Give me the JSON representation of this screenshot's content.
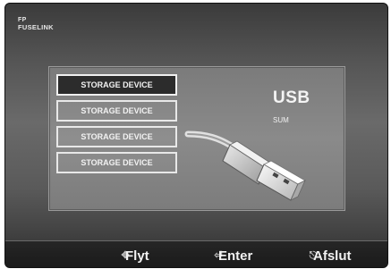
{
  "brand": {
    "logo": "FP",
    "name": "FUSELINK"
  },
  "devices": [
    {
      "label": "STORAGE DEVICE",
      "selected": true
    },
    {
      "label": "STORAGE DEVICE",
      "selected": false
    },
    {
      "label": "STORAGE DEVICE",
      "selected": false
    },
    {
      "label": "STORAGE DEVICE",
      "selected": false
    }
  ],
  "usb": {
    "title": "USB",
    "subtitle": "SUM"
  },
  "help": [
    {
      "icon": "move-arrows-icon",
      "label": "Flyt"
    },
    {
      "icon": "enter-icon",
      "label": "Enter"
    },
    {
      "icon": "exit-icon",
      "label": "Afslut"
    }
  ],
  "colors": {
    "background": "#5a5a5a",
    "panel": "#868686",
    "selected": "#2c2c2c",
    "text": "#f2f2f2"
  }
}
